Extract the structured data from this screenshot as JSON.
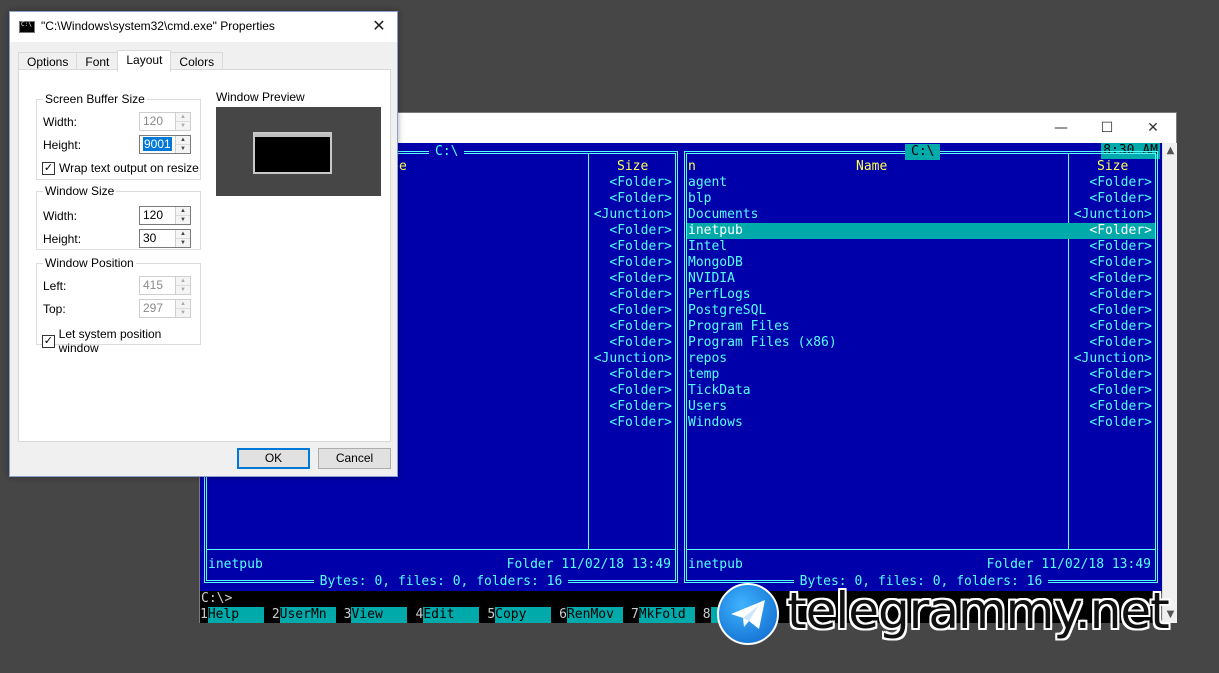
{
  "dialog": {
    "title": "\"C:\\Windows\\system32\\cmd.exe\" Properties",
    "tabs": [
      {
        "label": "Options"
      },
      {
        "label": "Font"
      },
      {
        "label": "Layout"
      },
      {
        "label": "Colors"
      }
    ],
    "buffer": {
      "title": "Screen Buffer Size",
      "width_label": "Width:",
      "width_value": "120",
      "height_label": "Height:",
      "height_value": "9001",
      "wrap_label": "Wrap text output on resize"
    },
    "window_size": {
      "title": "Window Size",
      "width_label": "Width:",
      "width_value": "120",
      "height_label": "Height:",
      "height_value": "30"
    },
    "window_position": {
      "title": "Window Position",
      "left_label": "Left:",
      "left_value": "415",
      "top_label": "Top:",
      "top_value": "297",
      "let_label": "Let system position window"
    },
    "preview_label": "Window Preview",
    "ok_label": "OK",
    "cancel_label": "Cancel"
  },
  "console": {
    "clock": "8:30 AM",
    "left_panel": {
      "path": "C:\\",
      "name_header": "e",
      "size_header": "Size",
      "sizes": [
        "<Folder>",
        "<Folder>",
        "<Junction>",
        "<Folder>",
        "<Folder>",
        "<Folder>",
        "<Folder>",
        "<Folder>",
        "<Folder>",
        "<Folder>",
        "<Folder>",
        "<Junction>",
        "<Folder>",
        "<Folder>",
        "<Folder>",
        "<Folder>"
      ],
      "info_name": "inetpub",
      "info_meta": "Folder 11/02/18 13:49",
      "bytes": "Bytes: 0, files: 0, folders: 16"
    },
    "right_panel": {
      "path": "C:\\",
      "n_header": "n",
      "name_header": "Name",
      "size_header": "Size",
      "rows": [
        {
          "name": "agent",
          "size": "<Folder>"
        },
        {
          "name": "blp",
          "size": "<Folder>"
        },
        {
          "name": "Documents",
          "size": "<Junction>"
        },
        {
          "name": "inetpub",
          "size": "<Folder>"
        },
        {
          "name": "Intel",
          "size": "<Folder>"
        },
        {
          "name": "MongoDB",
          "size": "<Folder>"
        },
        {
          "name": "NVIDIA",
          "size": "<Folder>"
        },
        {
          "name": "PerfLogs",
          "size": "<Folder>"
        },
        {
          "name": "PostgreSQL",
          "size": "<Folder>"
        },
        {
          "name": "Program Files",
          "size": "<Folder>"
        },
        {
          "name": "Program Files (x86)",
          "size": "<Folder>"
        },
        {
          "name": "repos",
          "size": "<Junction>"
        },
        {
          "name": "temp",
          "size": "<Folder>"
        },
        {
          "name": "TickData",
          "size": "<Folder>"
        },
        {
          "name": "Users",
          "size": "<Folder>"
        },
        {
          "name": "Windows",
          "size": "<Folder>"
        }
      ],
      "selected_index": 3,
      "info_name": "inetpub",
      "info_meta": "Folder 11/02/18 13:49",
      "bytes": "Bytes: 0, files: 0, folders: 16"
    },
    "command_line": "C:\\>",
    "keybar": [
      {
        "num": "1",
        "label": "Help"
      },
      {
        "num": "2",
        "label": "UserMn"
      },
      {
        "num": "3",
        "label": "View"
      },
      {
        "num": "4",
        "label": "Edit"
      },
      {
        "num": "5",
        "label": "Copy"
      },
      {
        "num": "6",
        "label": "RenMov"
      },
      {
        "num": "7",
        "label": "MkFold"
      },
      {
        "num": "8",
        "label": ""
      }
    ]
  },
  "watermark": {
    "text": "telegrammy.net"
  }
}
